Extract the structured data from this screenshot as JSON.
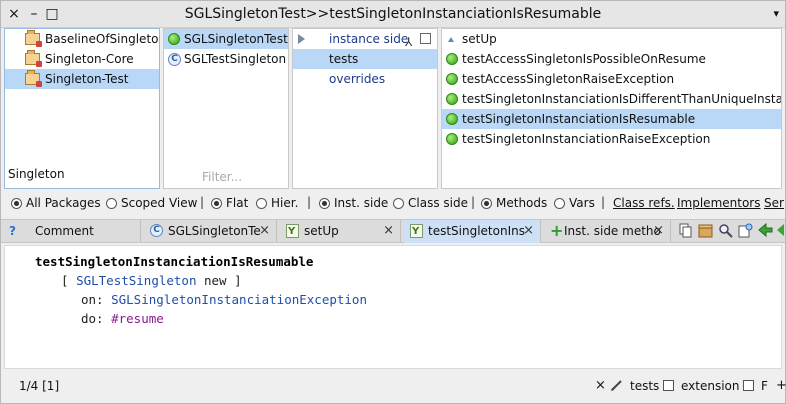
{
  "window": {
    "title": "SGLSingletonTest>>testSingletonInstanciationIsResumable",
    "close_glyph": "×",
    "minimize_glyph": "–",
    "maximize_glyph": "□",
    "menu_glyph": "▾"
  },
  "packages": {
    "items": [
      {
        "label": "BaselineOfSingleton",
        "icon": "package-icon"
      },
      {
        "label": "Singleton-Core",
        "icon": "package-icon"
      },
      {
        "label": "Singleton-Test",
        "icon": "package-icon",
        "selected": true
      }
    ],
    "filter_value": "Singleton"
  },
  "classes": {
    "items": [
      {
        "label": "SGLSingletonTest",
        "icon": "test-passed-icon",
        "selected": true
      },
      {
        "label": "SGLTestSingleton",
        "icon": "class-icon",
        "icon_text": "C"
      }
    ],
    "filter_placeholder": "Filter..."
  },
  "protocols": {
    "items": [
      {
        "label": "instance side",
        "expandable": true
      },
      {
        "label": "tests",
        "selected": true
      },
      {
        "label": "overrides"
      }
    ]
  },
  "methods": {
    "items": [
      {
        "label": "setUp",
        "icon": "caret-up-icon"
      },
      {
        "label": "testAccessSingletonIsPossibleOnResume",
        "icon": "test-passed-icon"
      },
      {
        "label": "testAccessSingletonRaiseException",
        "icon": "test-passed-icon"
      },
      {
        "label": "testSingletonInstanciationIsDifferentThanUniqueInstance",
        "icon": "test-passed-icon"
      },
      {
        "label": "testSingletonInstanciationIsResumable",
        "icon": "test-passed-icon",
        "selected": true
      },
      {
        "label": "testSingletonInstanciationRaiseException",
        "icon": "test-passed-icon"
      }
    ]
  },
  "toolbar": {
    "all_packages": "All Packages",
    "scoped_view": "Scoped View",
    "flat": "Flat",
    "hier": "Hier.",
    "inst_side": "Inst. side",
    "class_side": "Class side",
    "methods": "Methods",
    "vars": "Vars",
    "class_refs": "Class refs.",
    "implementors": "Implementors",
    "senders": "Ser",
    "separator": "|"
  },
  "tabs": [
    {
      "label": "Comment",
      "icon": "help-icon",
      "icon_text": "?"
    },
    {
      "label": "SGLSingletonTe",
      "icon": "class-icon",
      "icon_text": "C",
      "close": "×"
    },
    {
      "label": "setUp",
      "icon": "method-icon",
      "close": "×"
    },
    {
      "label": "testSingletonIns",
      "icon": "method-icon",
      "close": "×",
      "active": true
    },
    {
      "label": "Inst. side metho",
      "icon": "add-icon",
      "icon_text": "+",
      "close": "×"
    }
  ],
  "code": {
    "selector": "testSingletonInstanciationIsResumable",
    "line2_open": "[ ",
    "line2_class": "SGLTestSingleton",
    "line2_rest": " new ]",
    "line3_kw": "on: ",
    "line3_class": "SGLSingletonInstanciationException",
    "line4_kw": "do: ",
    "line4_sym": "#resume"
  },
  "status": {
    "position": "1/4 [1]",
    "close_glyph": "×",
    "protocol": "tests",
    "extension": "extension",
    "format": "F",
    "more_glyph": "+"
  }
}
